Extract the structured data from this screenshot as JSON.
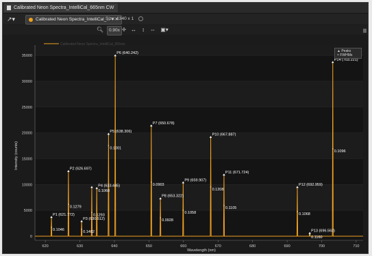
{
  "window": {
    "title": "Calibrated Neon Spectra_IntelliCal_665nm CW"
  },
  "toolbar": {
    "file_tab": "Calibrated Neon Spectra_IntelliCal_...",
    "size_label": "Size: 1340 x 1",
    "zoom_value": "0.90x"
  },
  "chart_data": {
    "type": "line",
    "title": "",
    "series_label": "Calibrated Neon Spectra_IntelliCal_665nm",
    "xlabel": "Wavelength (nm)",
    "ylabel": "Intensity (counts)",
    "xlim": [
      617,
      712
    ],
    "ylim": [
      -800,
      37000
    ],
    "xticks": [
      620,
      630,
      640,
      650,
      660,
      670,
      680,
      690,
      700,
      710
    ],
    "yticks": [
      0,
      5000,
      10000,
      15000,
      20000,
      25000,
      30000,
      35000
    ],
    "legend": [
      "Peaks",
      "FWHMs"
    ],
    "legend_position": "top-right",
    "color": "#f0a020",
    "peaks": [
      {
        "label": "P1 (621.772)",
        "x": 621.772,
        "y": 3700,
        "fwhm_label": "0.1046",
        "fwhm_y": 1800
      },
      {
        "label": "P2 (626.697)",
        "x": 626.697,
        "y": 12600,
        "fwhm_label": "0.1279",
        "fwhm_y": 6200
      },
      {
        "label": "P3 (630.512)",
        "x": 630.512,
        "y": 2900,
        "fwhm_label": "0.1482",
        "fwhm_y": 1400
      },
      {
        "label": "",
        "x": 633.45,
        "y": 9500,
        "fwhm_label": "0.1293",
        "fwhm_y": 4600
      },
      {
        "label": "P4 (633.445)",
        "x": 634.9,
        "y": 9300,
        "fwhm_label": "0.1068",
        "fwhm_y": 9300
      },
      {
        "label": "P5 (638.306)",
        "x": 638.306,
        "y": 19800,
        "fwhm_label": "0.1001",
        "fwhm_y": 17600
      },
      {
        "label": "P6 (640.242)",
        "x": 640.242,
        "y": 35000,
        "fwhm_label": "",
        "fwhm_y": 0
      },
      {
        "label": "P7 (650.678)",
        "x": 650.678,
        "y": 21400,
        "fwhm_label": "0.0903",
        "fwhm_y": 10500
      },
      {
        "label": "P8 (653.322)",
        "x": 653.322,
        "y": 7300,
        "fwhm_label": "0.0928",
        "fwhm_y": 3600
      },
      {
        "label": "P9 (659.907)",
        "x": 659.907,
        "y": 10400,
        "fwhm_label": "0.1058",
        "fwhm_y": 5100
      },
      {
        "label": "P10 (667.887)",
        "x": 667.887,
        "y": 19200,
        "fwhm_label": "0.1208",
        "fwhm_y": 9600
      },
      {
        "label": "P11 (671.724)",
        "x": 671.724,
        "y": 11900,
        "fwhm_label": "0.1105",
        "fwhm_y": 6000
      },
      {
        "label": "P12 (692.959)",
        "x": 692.959,
        "y": 9500,
        "fwhm_label": "0.1068",
        "fwhm_y": 4800
      },
      {
        "label": "P13 (696.563)",
        "x": 696.563,
        "y": 600,
        "fwhm_label": "0.1160",
        "fwhm_y": 300
      },
      {
        "label": "P14 (703.221)",
        "x": 703.221,
        "y": 33700,
        "fwhm_label": "0.1096",
        "fwhm_y": 17000
      }
    ]
  }
}
